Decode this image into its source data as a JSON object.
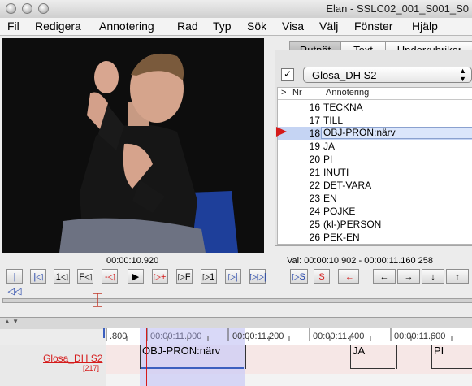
{
  "window": {
    "title": "Elan - SSLC02_001_S001_S0"
  },
  "menubar": {
    "items": [
      "Fil",
      "Redigera",
      "Annotering",
      "Rad",
      "Typ",
      "Sök",
      "Visa",
      "Välj",
      "Fönster",
      "Hjälp"
    ]
  },
  "tabs": [
    {
      "label": "Rutnät"
    },
    {
      "label": "Text"
    },
    {
      "label": "Underrubriker"
    }
  ],
  "tier_selector": {
    "checked": "✓",
    "selected": "Glosa_DH S2"
  },
  "table": {
    "columns": [
      ">",
      "Nr",
      "Annotering"
    ],
    "rows": [
      {
        "nr": "16",
        "value": "TECKNA"
      },
      {
        "nr": "17",
        "value": "TILL"
      },
      {
        "nr": "18",
        "value": "OBJ-PRON:närv"
      },
      {
        "nr": "19",
        "value": "JA"
      },
      {
        "nr": "20",
        "value": "PI"
      },
      {
        "nr": "21",
        "value": "INUTI"
      },
      {
        "nr": "22",
        "value": "DET-VARA"
      },
      {
        "nr": "23",
        "value": "EN"
      },
      {
        "nr": "24",
        "value": "POJKE"
      },
      {
        "nr": "25",
        "value": "(kl-)PERSON"
      },
      {
        "nr": "26",
        "value": "PEK-EN"
      }
    ]
  },
  "player": {
    "current_time": "00:00:10.920",
    "selection": "Val: 00:00:10.902 - 00:00:11.160  258",
    "controls": [
      "|◁◁",
      "|◁",
      "1◁",
      "F◁",
      "-◁",
      "▶",
      "▷+",
      "▷F",
      "▷1",
      "▷|",
      "▷▷|",
      "▷S",
      "S",
      "|←",
      "←",
      "→",
      "↓",
      "↑"
    ]
  },
  "timeline": {
    "ruler_labels": [
      ".800",
      "00:00:11.000",
      "00:00:11.200",
      "00:00:11.400",
      "00:00:11.600"
    ],
    "tier_name": "Glosa_DH S2",
    "tier_count": "[217]",
    "annotations": [
      "OBJ-PRON:närv",
      "JA",
      "PI"
    ]
  },
  "colors": {
    "accent": "#d51a1a",
    "selection": "#c5d4f3",
    "tier": "#f6e7e6"
  }
}
